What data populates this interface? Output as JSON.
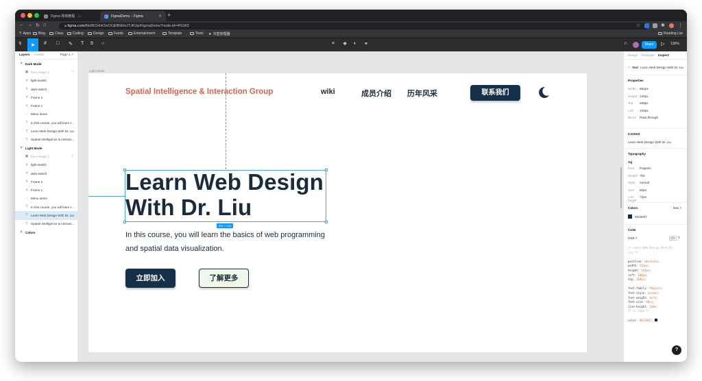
{
  "browser": {
    "tabs": [
      {
        "label": "Figma 简体教程",
        "active": false
      },
      {
        "label": "FigmaDemo – Figma",
        "active": true
      }
    ],
    "url_host": "figma.com",
    "url_rest": "/file/8iCHnK0vOOjRBWmJTJKUp/FigmaDemo?node-id=4%3A3",
    "bookmarks": [
      "Apps",
      "Blog",
      "Class",
      "Coding",
      "Design",
      "Feeds",
      "Entertainment",
      "Template",
      "Tools",
      "书签管理器"
    ],
    "reading_list": "Reading List"
  },
  "toolbar": {
    "share_label": "Share",
    "zoom": "130%"
  },
  "left_panel": {
    "tab_layers": "Layers",
    "tab_assets": "Assets",
    "page": "Page 1",
    "layers": [
      {
        "label": "Dark Mode",
        "kind": "frame",
        "top": true
      },
      {
        "label": "hero image 1",
        "kind": "image",
        "faint": true,
        "chev": true
      },
      {
        "label": "light-switch",
        "kind": "frame"
      },
      {
        "label": "dark-switch",
        "kind": "frame"
      },
      {
        "label": "Frame 2",
        "kind": "frame"
      },
      {
        "label": "Frame 1",
        "kind": "frame"
      },
      {
        "label": "Menu items",
        "kind": "group"
      },
      {
        "label": "In this course, you will learn t...",
        "kind": "text"
      },
      {
        "label": "Learn Web Design With Dr. Liu",
        "kind": "text"
      },
      {
        "label": "Spatial Intelligence & Interact...",
        "kind": "text"
      },
      {
        "label": "Light Mode",
        "kind": "frame",
        "top": true
      },
      {
        "label": "hero image 1",
        "kind": "image",
        "faint": true,
        "chev": true
      },
      {
        "label": "light-switch",
        "kind": "frame"
      },
      {
        "label": "dark-switch",
        "kind": "frame"
      },
      {
        "label": "Frame 2",
        "kind": "frame"
      },
      {
        "label": "Frame 1",
        "kind": "frame"
      },
      {
        "label": "Menu items",
        "kind": "group"
      },
      {
        "label": "In this course, you will learn t...",
        "kind": "text"
      },
      {
        "label": "Learn Web Design With Dr. Liu",
        "kind": "text",
        "selected": true
      },
      {
        "label": "Spatial Intelligence & Interact...",
        "kind": "text"
      },
      {
        "label": "Colors",
        "kind": "frame",
        "top": true
      }
    ]
  },
  "canvas": {
    "frame_label": "Light Mode",
    "site": {
      "logo": "Spatial Intelligence & Interaction Group",
      "nav": [
        "wiki",
        "成员介绍",
        "历年风采"
      ],
      "contact_button": "联系我们",
      "headline_line1": "Learn Web Design",
      "headline_line2": "With Dr. Liu",
      "dims_badge": "552 × 144",
      "subtext_line1": "In this course, you will learn the basics of web programming",
      "subtext_line2": "and spatial data visualization.",
      "join_button": "立即加入",
      "learn_more_button": "了解更多"
    }
  },
  "right_panel": {
    "tabs": [
      "Design",
      "Prototype",
      "Inspect"
    ],
    "selected_label": "Text",
    "selected_name": "Learn Web Design With Dr. Liu",
    "properties_title": "Properties",
    "properties": [
      {
        "k": "Width",
        "v": "552px"
      },
      {
        "k": "Height",
        "v": "144px"
      },
      {
        "k": "Top",
        "v": "269px"
      },
      {
        "k": "Left",
        "v": "100px"
      },
      {
        "k": "Blend",
        "v": "Pass through"
      }
    ],
    "content_title": "Content",
    "content_value": "Learn Web Design With Dr. Liu",
    "typography_title": "Typography",
    "typography_sample": "Ag",
    "typography": [
      {
        "k": "Font",
        "v": "Poppins"
      },
      {
        "k": "Weight",
        "v": "700"
      },
      {
        "k": "Style",
        "v": "normal"
      },
      {
        "k": "Size",
        "v": "60px"
      },
      {
        "k": "Line height",
        "v": "72px"
      }
    ],
    "colors_title": "Colors",
    "colors_format": "Hex",
    "color_value": "#023047",
    "code_title": "Code",
    "code_lang": "CSS",
    "code_comment1": "/* Learn Web Design With Dr.",
    "code_comment2": "Liu */",
    "code_props": [
      {
        "p": "position",
        "v": "absolute"
      },
      {
        "p": "width",
        "v": "552px"
      },
      {
        "p": "height",
        "v": "144px"
      },
      {
        "p": "left",
        "v": "100px"
      },
      {
        "p": "top",
        "v": "269px"
      }
    ],
    "code_font_props": [
      {
        "p": "font-family",
        "v": "Poppins"
      },
      {
        "p": "font-style",
        "v": "normal"
      },
      {
        "p": "font-weight",
        "v": "bold"
      },
      {
        "p": "font-size",
        "v": "60px"
      },
      {
        "p": "line-height",
        "v": "120%"
      }
    ],
    "code_lh_comment": "/* or 72px */",
    "code_color_prop": "color",
    "code_color_value": "#023047"
  },
  "colors": {
    "accent": "#0d99ff",
    "logo_red": "#e05f4f",
    "navy": "#16304a",
    "text_dark": "#023047"
  }
}
